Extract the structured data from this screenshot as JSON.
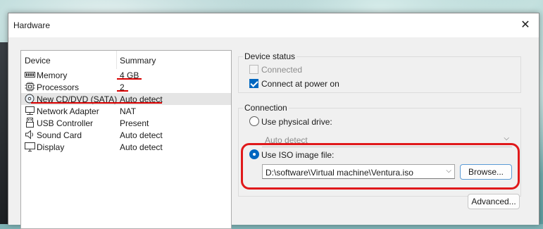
{
  "window": {
    "title": "Hardware"
  },
  "device_list": {
    "columns": [
      "Device",
      "Summary"
    ],
    "rows": [
      {
        "device": "Memory",
        "summary": "4 GB",
        "icon": "memory-icon"
      },
      {
        "device": "Processors",
        "summary": "2",
        "icon": "processor-icon"
      },
      {
        "device": "New CD/DVD (SATA)",
        "summary": "Auto detect",
        "icon": "cd-dvd-icon",
        "selected": true
      },
      {
        "device": "Network Adapter",
        "summary": "NAT",
        "icon": "network-icon"
      },
      {
        "device": "USB Controller",
        "summary": "Present",
        "icon": "usb-icon"
      },
      {
        "device": "Sound Card",
        "summary": "Auto detect",
        "icon": "speaker-icon"
      },
      {
        "device": "Display",
        "summary": "Auto detect",
        "icon": "monitor-icon"
      }
    ]
  },
  "device_status": {
    "label": "Device status",
    "connected": {
      "label": "Connected",
      "checked": false,
      "enabled": false
    },
    "connect_at_power_on": {
      "label": "Connect at power on",
      "checked": true
    }
  },
  "connection": {
    "label": "Connection",
    "physical": {
      "label": "Use physical drive:",
      "selected": false,
      "value": "Auto detect"
    },
    "iso": {
      "label": "Use ISO image file:",
      "selected": true,
      "value": "D:\\software\\Virtual machine\\Ventura.iso"
    },
    "browse_label": "Browse..."
  },
  "advanced_label": "Advanced...",
  "colors": {
    "accent": "#0067c0",
    "annotation_red": "#e0191b"
  }
}
